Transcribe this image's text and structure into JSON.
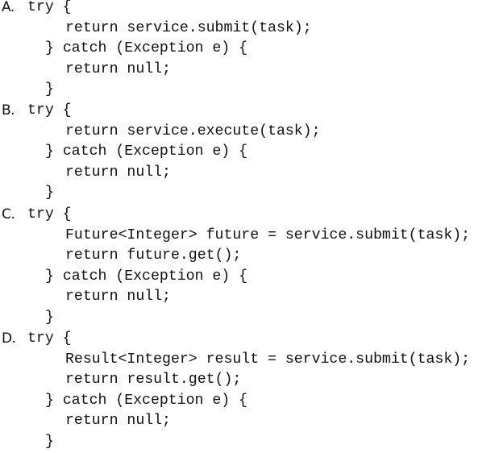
{
  "options": [
    {
      "label": "A.",
      "lines": [
        "try {",
        "return service.submit(task);",
        "} catch (Exception e) {",
        "return null;",
        "}"
      ]
    },
    {
      "label": "B.",
      "lines": [
        "try {",
        "return service.execute(task);",
        "} catch (Exception e) {",
        "return null;",
        "}"
      ]
    },
    {
      "label": "C.",
      "lines": [
        "try {",
        "Future<Integer> future = service.submit(task);",
        "return future.get();",
        "} catch (Exception e) {",
        "return null;",
        "}"
      ]
    },
    {
      "label": "D.",
      "lines": [
        "try {",
        "Result<Integer> result = service.submit(task);",
        "return result.get();",
        "} catch (Exception e) {",
        "return null;",
        "}"
      ]
    }
  ]
}
